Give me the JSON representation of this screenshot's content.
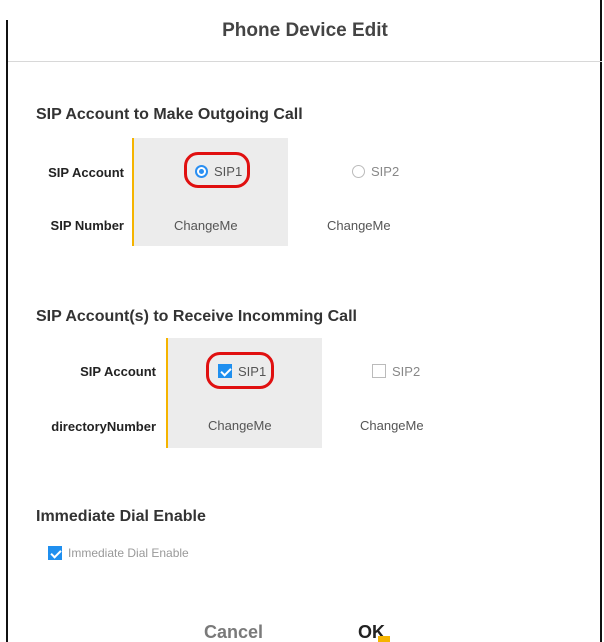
{
  "dialog": {
    "title": "Phone Device Edit"
  },
  "outgoing": {
    "title": "SIP Account to Make Outgoing Call",
    "sip_account_label": "SIP Account",
    "sip_number_label": "SIP Number",
    "options": [
      {
        "label": "SIP1",
        "selected": true,
        "number": "ChangeMe"
      },
      {
        "label": "SIP2",
        "selected": false,
        "number": "ChangeMe"
      }
    ]
  },
  "incoming": {
    "title": "SIP Account(s) to Receive Incomming Call",
    "sip_account_label": "SIP Account",
    "directory_label": "directoryNumber",
    "options": [
      {
        "label": "SIP1",
        "checked": true,
        "number": "ChangeMe"
      },
      {
        "label": "SIP2",
        "checked": false,
        "number": "ChangeMe"
      }
    ]
  },
  "immediate": {
    "title": "Immediate Dial Enable",
    "checkbox_label": "Immediate Dial Enable",
    "checked": true
  },
  "footer": {
    "cancel_label": "Cancel",
    "ok_label": "OK"
  },
  "colors": {
    "accent": "#f5b400",
    "primary": "#2a8ff2",
    "highlight": "#e01010",
    "shaded": "#ececec"
  }
}
